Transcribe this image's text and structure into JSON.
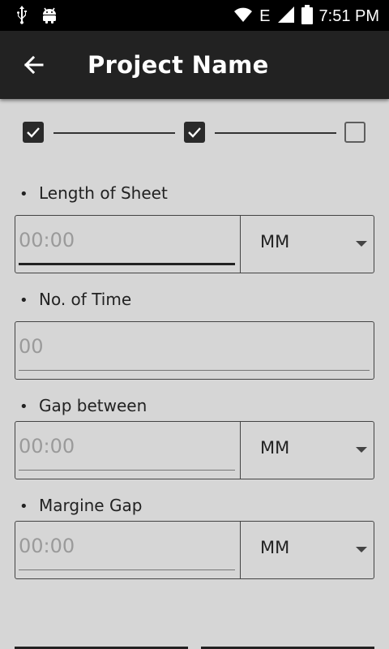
{
  "status_bar": {
    "time": "7:51 PM",
    "network_type": "E",
    "icons": [
      "usb-icon",
      "android-icon",
      "wifi-icon",
      "signal-icon",
      "battery-icon"
    ]
  },
  "app_bar": {
    "title": "Project Name",
    "back_icon": "arrow-left-icon"
  },
  "stepper": {
    "steps": [
      {
        "checked": true
      },
      {
        "checked": true
      },
      {
        "checked": false
      }
    ]
  },
  "fields": {
    "length_of_sheet": {
      "bullet": "•",
      "label": "Length of Sheet",
      "placeholder": "00:00",
      "unit": "MM"
    },
    "no_of_time": {
      "bullet": "•",
      "label": "No. of Time",
      "placeholder": "00"
    },
    "gap_between": {
      "bullet": "•",
      "label": "Gap between",
      "placeholder": "00:00",
      "unit": "MM"
    },
    "margine_gap": {
      "bullet": "•",
      "label": "Margine Gap",
      "placeholder": "00:00",
      "unit": "MM"
    }
  },
  "colors": {
    "app_bar": "#222222",
    "background": "#d6d6d6",
    "status_bar": "#000000"
  }
}
